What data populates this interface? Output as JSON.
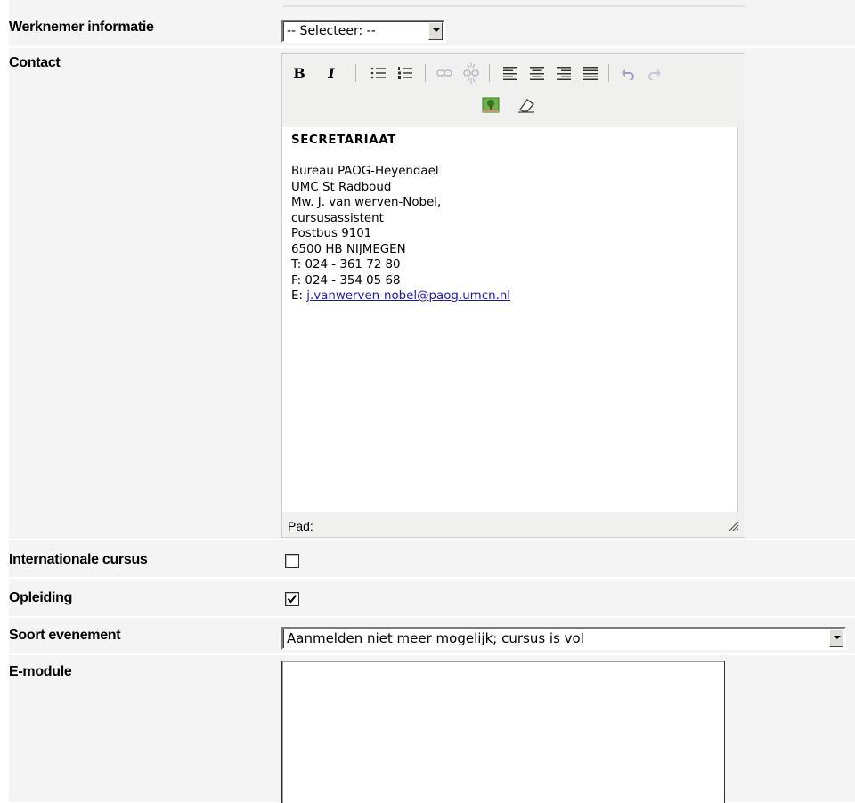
{
  "form": {
    "werknemer": {
      "label": "Werknemer informatie",
      "select_value": "-- Selecteer: --"
    },
    "contact": {
      "label": "Contact",
      "toolbar": {
        "bold": "B",
        "italic": "I",
        "icons": [
          "bold-icon",
          "italic-icon",
          "unordered-list-icon",
          "ordered-list-icon",
          "link-icon",
          "unlink-icon",
          "align-left-icon",
          "align-center-icon",
          "align-right-icon",
          "align-justify-icon",
          "undo-icon",
          "redo-icon",
          "insert-image-icon",
          "eraser-icon"
        ]
      },
      "content": {
        "heading": "SECRETARIAAT",
        "lines": [
          "Bureau PAOG-Heyendael",
          "UMC St Radboud",
          "Mw. J. van werven-Nobel,",
          "cursusassistent",
          "Postbus 9101",
          "6500 HB NIJMEGEN",
          "T: 024 - 361 72 80",
          "F: 024 - 354 05 68"
        ],
        "email_prefix": "E: ",
        "email": "j.vanwerven-nobel@paog.umcn.nl"
      },
      "status_label": "Pad:"
    },
    "internationale": {
      "label": "Internationale cursus",
      "checked": false
    },
    "opleiding": {
      "label": "Opleiding",
      "checked": true
    },
    "soort": {
      "label": "Soort evenement",
      "select_value": "Aanmelden niet meer mogelijk; cursus is vol"
    },
    "emodule": {
      "label": "E-module",
      "value": ""
    }
  }
}
